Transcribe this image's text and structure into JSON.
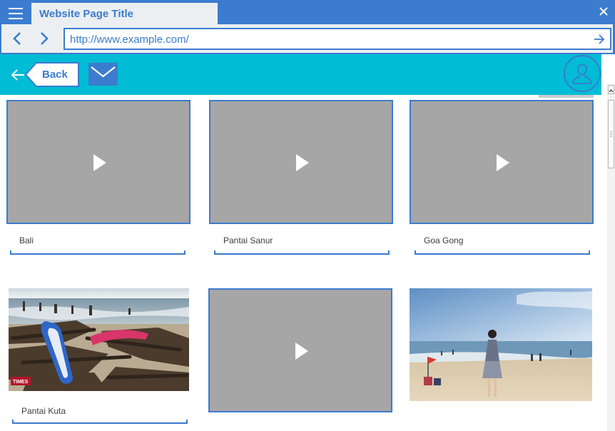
{
  "browser": {
    "tab_title": "Website Page Title",
    "url": "http://www.example.com/"
  },
  "icons": {
    "menu": "hamburger-menu-icon",
    "close": "close-icon",
    "back": "chevron-left-icon",
    "forward": "chevron-right-icon",
    "go": "arrow-right-icon",
    "header_back": "arrow-left-icon",
    "mail": "mail-icon",
    "avatar": "user-icon",
    "play": "play-icon"
  },
  "header": {
    "back_label": "Back"
  },
  "cards": [
    {
      "caption": "Bali",
      "media": "video"
    },
    {
      "caption": "Pantai Sanur",
      "media": "video"
    },
    {
      "caption": "Goa Gong",
      "media": "video"
    },
    {
      "caption": "Pantai Kuta",
      "media": "photo",
      "watermark": "TIMES"
    },
    {
      "caption": "",
      "media": "video"
    },
    {
      "caption": "",
      "media": "photo"
    }
  ],
  "colors": {
    "chrome": "#3b7ccf",
    "header": "#00bcd4",
    "placeholder": "#a6a6a6"
  }
}
